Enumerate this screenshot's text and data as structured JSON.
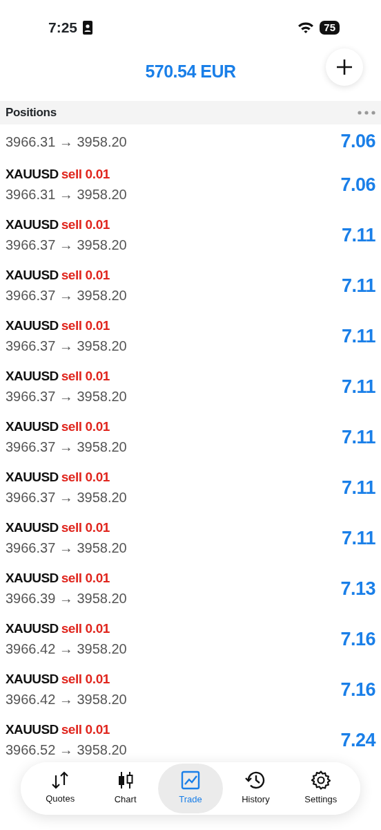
{
  "status_bar": {
    "time": "7:25",
    "battery": "75"
  },
  "balance": "570.54 EUR",
  "section": {
    "title": "Positions"
  },
  "positions": [
    {
      "kind": "cut",
      "prices": "3966.31 → 3958.20",
      "profit": "7.06"
    },
    {
      "kind": "full",
      "symbol": "XAUUSD",
      "side": "sell 0.01",
      "prices": "3966.31 → 3958.20",
      "profit": "7.06"
    },
    {
      "kind": "full",
      "symbol": "XAUUSD",
      "side": "sell 0.01",
      "prices": "3966.37 → 3958.20",
      "profit": "7.11"
    },
    {
      "kind": "full",
      "symbol": "XAUUSD",
      "side": "sell 0.01",
      "prices": "3966.37 → 3958.20",
      "profit": "7.11"
    },
    {
      "kind": "full",
      "symbol": "XAUUSD",
      "side": "sell 0.01",
      "prices": "3966.37 → 3958.20",
      "profit": "7.11"
    },
    {
      "kind": "full",
      "symbol": "XAUUSD",
      "side": "sell 0.01",
      "prices": "3966.37 → 3958.20",
      "profit": "7.11"
    },
    {
      "kind": "full",
      "symbol": "XAUUSD",
      "side": "sell 0.01",
      "prices": "3966.37 → 3958.20",
      "profit": "7.11"
    },
    {
      "kind": "full",
      "symbol": "XAUUSD",
      "side": "sell 0.01",
      "prices": "3966.37 → 3958.20",
      "profit": "7.11"
    },
    {
      "kind": "full",
      "symbol": "XAUUSD",
      "side": "sell 0.01",
      "prices": "3966.37 → 3958.20",
      "profit": "7.11"
    },
    {
      "kind": "full",
      "symbol": "XAUUSD",
      "side": "sell 0.01",
      "prices": "3966.39 → 3958.20",
      "profit": "7.13"
    },
    {
      "kind": "full",
      "symbol": "XAUUSD",
      "side": "sell 0.01",
      "prices": "3966.42 → 3958.20",
      "profit": "7.16"
    },
    {
      "kind": "full",
      "symbol": "XAUUSD",
      "side": "sell 0.01",
      "prices": "3966.42 → 3958.20",
      "profit": "7.16"
    },
    {
      "kind": "full",
      "symbol": "XAUUSD",
      "side": "sell 0.01",
      "prices": "3966.52 → 3958.20",
      "profit": "7.24"
    }
  ],
  "tab_bar": [
    {
      "label": "Quotes",
      "kind": "quotes",
      "selected": false
    },
    {
      "label": "Chart",
      "kind": "chart",
      "selected": false
    },
    {
      "label": "Trade",
      "kind": "trade",
      "selected": true
    },
    {
      "label": "History",
      "kind": "history",
      "selected": false
    },
    {
      "label": "Settings",
      "kind": "settings",
      "selected": false
    }
  ]
}
